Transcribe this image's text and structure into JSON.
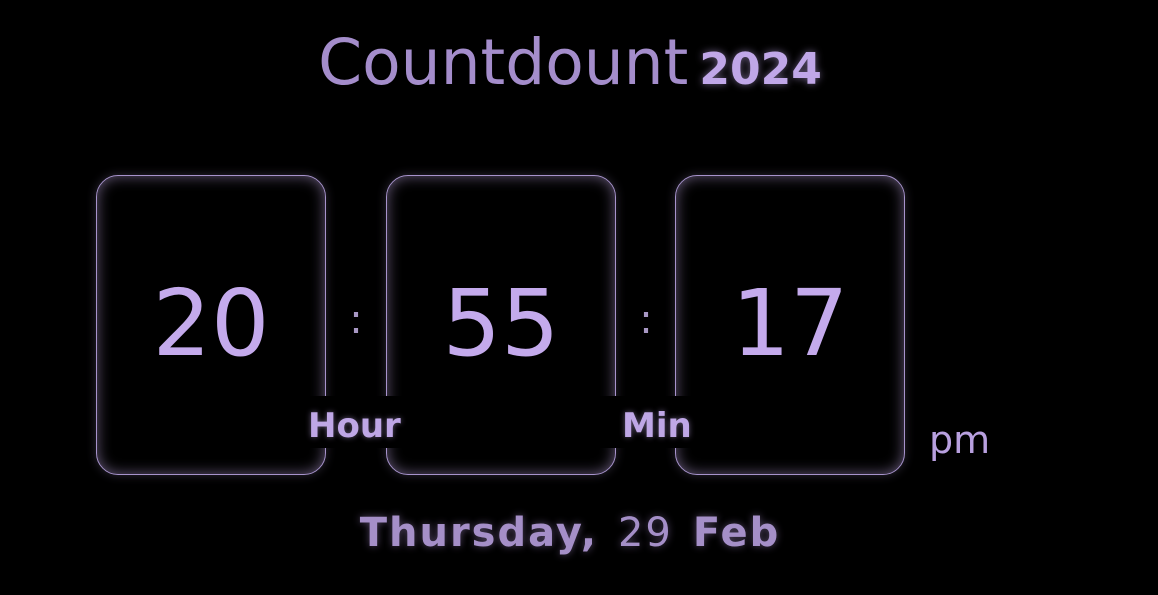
{
  "header": {
    "title": "Countdount",
    "year": "2024"
  },
  "clock": {
    "hours": "20",
    "minutes": "55",
    "seconds": "17",
    "separator": ":",
    "hour_label": "Hour",
    "minute_label": "Min",
    "meridiem": "pm"
  },
  "date": {
    "weekday": "Thursday,",
    "day": "29",
    "month": "Feb"
  },
  "colors": {
    "background": "#000000",
    "accent": "#b9a3dc"
  }
}
